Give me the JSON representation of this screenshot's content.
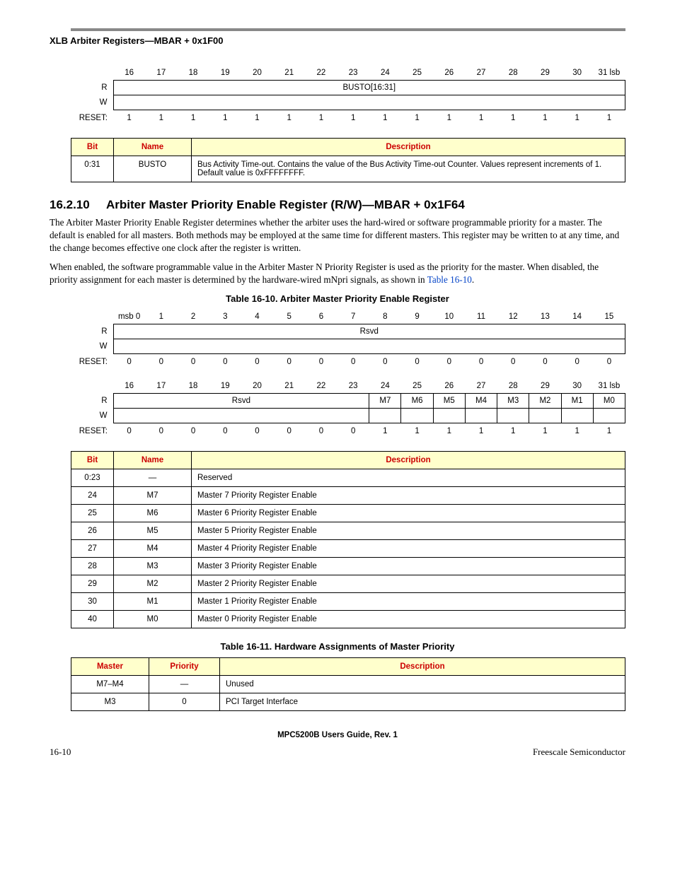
{
  "header": {
    "running": "XLB Arbiter Registers—MBAR + 0x1F00"
  },
  "reg1": {
    "bitnums": [
      "16",
      "17",
      "18",
      "19",
      "20",
      "21",
      "22",
      "23",
      "24",
      "25",
      "26",
      "27",
      "28",
      "29",
      "30",
      "31 lsb"
    ],
    "r_label": "R",
    "w_label": "W",
    "reset_label": "RESET:",
    "field_label": "BUSTO[16:31]",
    "reset": [
      "1",
      "1",
      "1",
      "1",
      "1",
      "1",
      "1",
      "1",
      "1",
      "1",
      "1",
      "1",
      "1",
      "1",
      "1",
      "1"
    ]
  },
  "def1": {
    "cols": [
      "Bit",
      "Name",
      "Description"
    ],
    "rows": [
      {
        "bit": "0:31",
        "name": "BUSTO",
        "desc": "Bus Activity Time-out. Contains the value of the Bus Activity Time-out Counter. Values represent increments of 1. Default value is 0xFFFFFFFF."
      }
    ]
  },
  "section": {
    "num": "16.2.10",
    "title": "Arbiter Master Priority Enable Register (R/W)—MBAR + 0x1F64",
    "p1": "The Arbiter Master Priority Enable Register determines whether the arbiter uses the hard-wired or software programmable priority for a master. The default is enabled for all masters. Both methods may be employed at the same time for different masters. This register may be written to at any time, and the change becomes effective one clock after the register is written.",
    "p2a": "When enabled, the software programmable value in the Arbiter Master N Priority Register is used as the priority for the master. When disabled, the priority assignment for each master is determined by the hardware-wired mNpri signals, as shown in ",
    "p2_link": "Table 16-10",
    "p2b": "."
  },
  "table1610_title": "Table 16-10. Arbiter Master Priority Enable Register",
  "reg2": {
    "top": {
      "bitnums": [
        "msb 0",
        "1",
        "2",
        "3",
        "4",
        "5",
        "6",
        "7",
        "8",
        "9",
        "10",
        "11",
        "12",
        "13",
        "14",
        "15"
      ],
      "r_label": "R",
      "w_label": "W",
      "reset_label": "RESET:",
      "field_label": "Rsvd",
      "reset": [
        "0",
        "0",
        "0",
        "0",
        "0",
        "0",
        "0",
        "0",
        "0",
        "0",
        "0",
        "0",
        "0",
        "0",
        "0",
        "0"
      ]
    },
    "bot": {
      "bitnums": [
        "16",
        "17",
        "18",
        "19",
        "20",
        "21",
        "22",
        "23",
        "24",
        "25",
        "26",
        "27",
        "28",
        "29",
        "30",
        "31 lsb"
      ],
      "r_label": "R",
      "w_label": "W",
      "reset_label": "RESET:",
      "rsvd_label": "Rsvd",
      "fields": [
        "M7",
        "M6",
        "M5",
        "M4",
        "M3",
        "M2",
        "M1",
        "M0"
      ],
      "reset": [
        "0",
        "0",
        "0",
        "0",
        "0",
        "0",
        "0",
        "0",
        "1",
        "1",
        "1",
        "1",
        "1",
        "1",
        "1",
        "1"
      ]
    }
  },
  "def2": {
    "cols": [
      "Bit",
      "Name",
      "Description"
    ],
    "rows": [
      {
        "bit": "0:23",
        "name": "—",
        "desc": "Reserved"
      },
      {
        "bit": "24",
        "name": "M7",
        "desc": "Master 7 Priority Register Enable"
      },
      {
        "bit": "25",
        "name": "M6",
        "desc": "Master 6 Priority Register Enable"
      },
      {
        "bit": "26",
        "name": "M5",
        "desc": "Master 5 Priority Register Enable"
      },
      {
        "bit": "27",
        "name": "M4",
        "desc": "Master 4 Priority Register Enable"
      },
      {
        "bit": "28",
        "name": "M3",
        "desc": "Master 3 Priority Register Enable"
      },
      {
        "bit": "29",
        "name": "M2",
        "desc": "Master 2 Priority Register Enable"
      },
      {
        "bit": "30",
        "name": "M1",
        "desc": "Master 1 Priority Register Enable"
      },
      {
        "bit": "40",
        "name": "M0",
        "desc": "Master 0 Priority Register Enable"
      }
    ]
  },
  "table1611_title": "Table 16-11. Hardware Assignments of Master Priority",
  "def3": {
    "cols": [
      "Master",
      "Priority",
      "Description"
    ],
    "rows": [
      {
        "m": "M7–M4",
        "p": "—",
        "desc": "Unused"
      },
      {
        "m": "M3",
        "p": "0",
        "desc": "PCI Target Interface"
      }
    ]
  },
  "footer": {
    "doc": "MPC5200B Users Guide, Rev. 1",
    "pg": "16-10",
    "company": "Freescale Semiconductor"
  }
}
